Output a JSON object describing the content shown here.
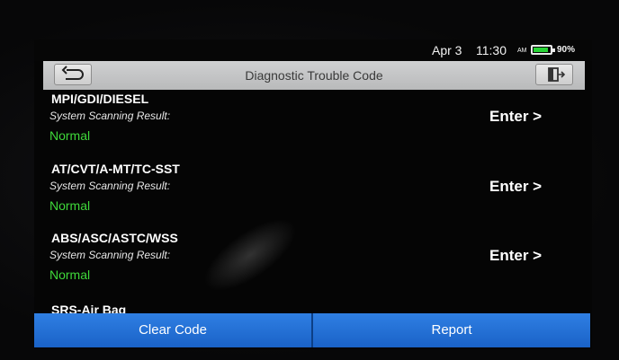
{
  "status_bar": {
    "date": "Apr 3",
    "time": "11:30",
    "ampm": "AM",
    "battery_percent": "90%",
    "battery_level": 0.9
  },
  "header": {
    "title": "Diagnostic Trouble Code",
    "back_icon": "back-arrow-icon",
    "exit_icon": "exit-door-icon"
  },
  "systems": [
    {
      "name": "MPI/GDI/DIESEL",
      "label": "System Scanning Result:",
      "result": "Normal",
      "action": "Enter >"
    },
    {
      "name": "AT/CVT/A-MT/TC-SST",
      "label": "System Scanning Result:",
      "result": "Normal",
      "action": "Enter >"
    },
    {
      "name": "ABS/ASC/ASTC/WSS",
      "label": "System Scanning Result:",
      "result": "Normal",
      "action": "Enter >"
    },
    {
      "name": "SRS-Air Bag"
    }
  ],
  "footer": {
    "clear_code": "Clear Code",
    "report": "Report"
  },
  "colors": {
    "result_normal": "#3fd93a",
    "button_blue": "#2b78dd",
    "title_bar": "#c4c5c6",
    "battery_fill": "#28d336"
  }
}
